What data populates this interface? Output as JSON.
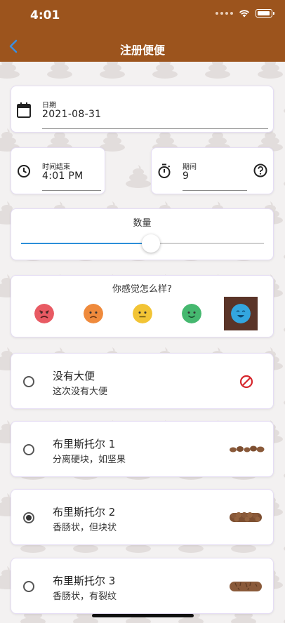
{
  "status_bar": {
    "time": "4:01"
  },
  "nav": {
    "title": "注册便便",
    "back_icon": "chevron-left-icon"
  },
  "date_field": {
    "label": "日期",
    "value": "2021-08-31",
    "icon": "calendar-icon"
  },
  "time_field": {
    "label": "时间结束",
    "value": "4:01 PM",
    "icon": "clock-icon"
  },
  "duration_field": {
    "label": "期间",
    "value": "9",
    "icon": "stopwatch-icon",
    "help_icon": "help-circle-icon"
  },
  "amount": {
    "title": "数量",
    "level": 0.5,
    "accent": "#2c8fd9"
  },
  "mood": {
    "title": "你感觉怎么样?",
    "faces": [
      {
        "name": "angry-face-icon",
        "color": "#e85a63"
      },
      {
        "name": "sad-face-icon",
        "color": "#ef8a3c"
      },
      {
        "name": "neutral-face-icon",
        "color": "#f2c435"
      },
      {
        "name": "smile-face-icon",
        "color": "#45b86f"
      },
      {
        "name": "happy-face-icon",
        "color": "#33a6df",
        "selected": true
      }
    ]
  },
  "options": [
    {
      "title": "没有大便",
      "subtitle": "这次没有大便",
      "icon": "no-entry-icon",
      "selected": false
    },
    {
      "title": "布里斯托尔 1",
      "subtitle": "分离硬块，如坚果",
      "icon": "bristol-type1-icon",
      "selected": false
    },
    {
      "title": "布里斯托尔 2",
      "subtitle": "香肠状，但块状",
      "icon": "bristol-type2-icon",
      "selected": true
    },
    {
      "title": "布里斯托尔 3",
      "subtitle": "香肠状，有裂纹",
      "icon": "bristol-type3-icon",
      "selected": false
    }
  ],
  "colors": {
    "header": "#9c541d",
    "card_border": "#e5ddf4",
    "stool": "#8a5a3a"
  }
}
